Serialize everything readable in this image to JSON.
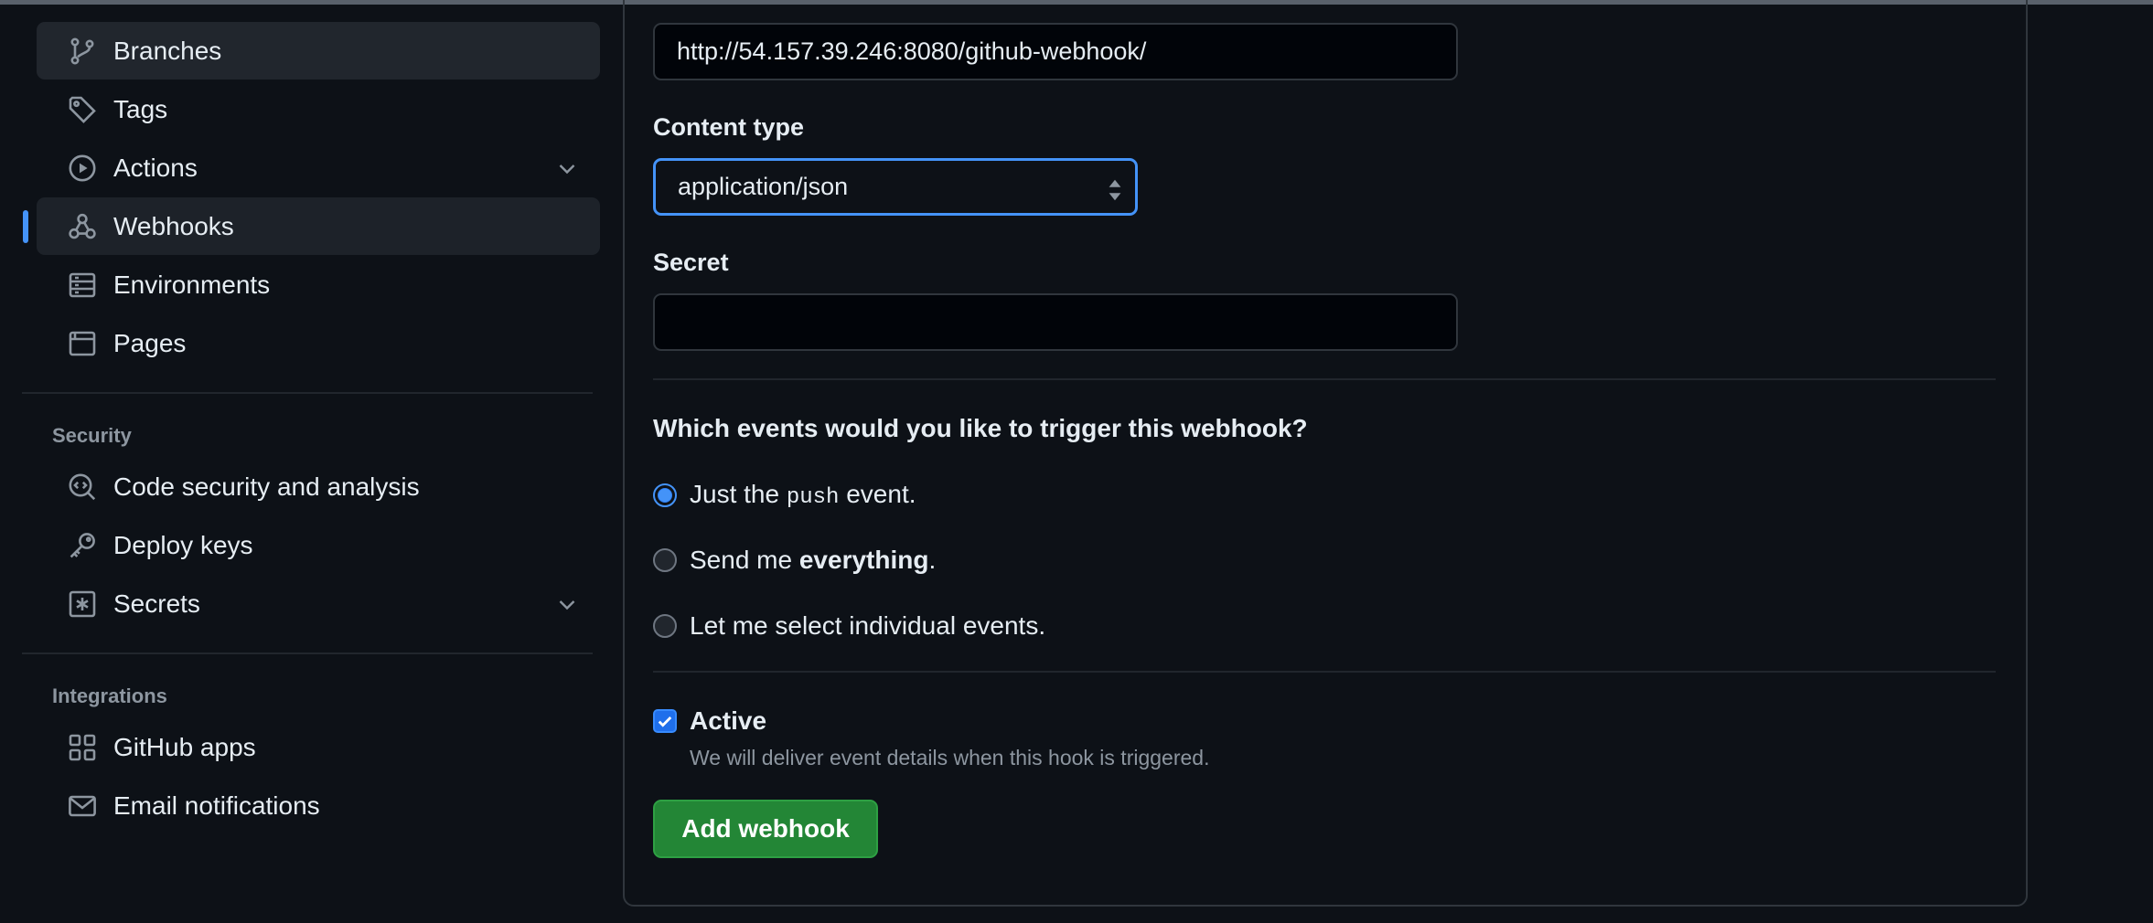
{
  "sidebar": {
    "items": [
      {
        "label": "Branches",
        "icon": "git-branch-icon"
      },
      {
        "label": "Tags",
        "icon": "tag-icon"
      },
      {
        "label": "Actions",
        "icon": "play-icon",
        "expandable": true
      },
      {
        "label": "Webhooks",
        "icon": "webhook-icon",
        "active": true
      },
      {
        "label": "Environments",
        "icon": "server-icon"
      },
      {
        "label": "Pages",
        "icon": "browser-icon"
      }
    ],
    "security_title": "Security",
    "security_items": [
      {
        "label": "Code security and analysis",
        "icon": "codescan-icon"
      },
      {
        "label": "Deploy keys",
        "icon": "key-icon"
      },
      {
        "label": "Secrets",
        "icon": "asterisk-icon",
        "expandable": true
      }
    ],
    "integrations_title": "Integrations",
    "integrations_items": [
      {
        "label": "GitHub apps",
        "icon": "apps-icon"
      },
      {
        "label": "Email notifications",
        "icon": "mail-icon"
      }
    ]
  },
  "form": {
    "payload_url_value": "http://54.157.39.246:8080/github-webhook/",
    "content_type_label": "Content type",
    "content_type_value": "application/json",
    "secret_label": "Secret",
    "secret_value": "",
    "events_question": "Which events would you like to trigger this webhook?",
    "event_options": {
      "push_prefix": "Just the ",
      "push_code": "push",
      "push_suffix": " event.",
      "everything_prefix": "Send me ",
      "everything_bold": "everything",
      "everything_suffix": ".",
      "individual": "Let me select individual events."
    },
    "selected_event": "push",
    "active_label": "Active",
    "active_checked": true,
    "active_hint": "We will deliver event details when this hook is triggered.",
    "submit_label": "Add webhook"
  },
  "colors": {
    "background": "#0d1117",
    "accent": "#4493f8",
    "primary_button": "#238636"
  }
}
